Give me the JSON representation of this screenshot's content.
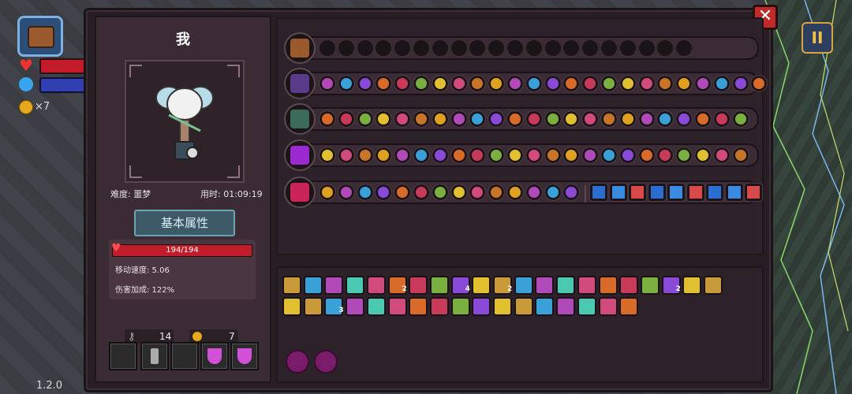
{
  "hud": {
    "coins_label": "×7",
    "version": "1.2.0",
    "pause_symbol": "II",
    "close_symbol": "✕"
  },
  "character": {
    "name": "我",
    "difficulty_label": "难度: 噩梦",
    "time_label": "用时: 01:09:19",
    "tab_title": "基本属性",
    "hp_text": "194/194",
    "move_speed_label": "移动速度: 5.06",
    "damage_bonus_label": "伤害加成: 122%",
    "keys": "14",
    "coins": "7",
    "slots": [
      "empty",
      "scroll",
      "empty",
      "potion",
      "potion"
    ]
  },
  "weapon_rows": [
    {
      "weapon": "chest",
      "color": "#9b5a2e",
      "dots": 20,
      "filled": 0
    },
    {
      "weapon": "staff-purple",
      "color": "#5a3a8a",
      "dots": 24,
      "filled": 24
    },
    {
      "weapon": "wand-green",
      "color": "#3a6a5a",
      "dots": 23,
      "filled": 23
    },
    {
      "weapon": "spellbook",
      "color": "#9a2ad0",
      "dots": 23,
      "filled": 23
    },
    {
      "weapon": "spellbook-red",
      "color": "#c8245a",
      "dots": 14,
      "filled": 14,
      "extra": 9
    }
  ],
  "item_counts": {
    "row1": [
      "",
      "",
      "",
      "",
      "",
      "2",
      "",
      "",
      "4",
      "",
      "2",
      "",
      "",
      "",
      "",
      "",
      "",
      "",
      "2",
      "",
      ""
    ],
    "row2": [
      "",
      "",
      "3",
      "",
      "",
      "",
      "",
      "",
      "",
      "",
      "",
      "",
      "",
      "",
      "",
      "",
      ""
    ]
  }
}
